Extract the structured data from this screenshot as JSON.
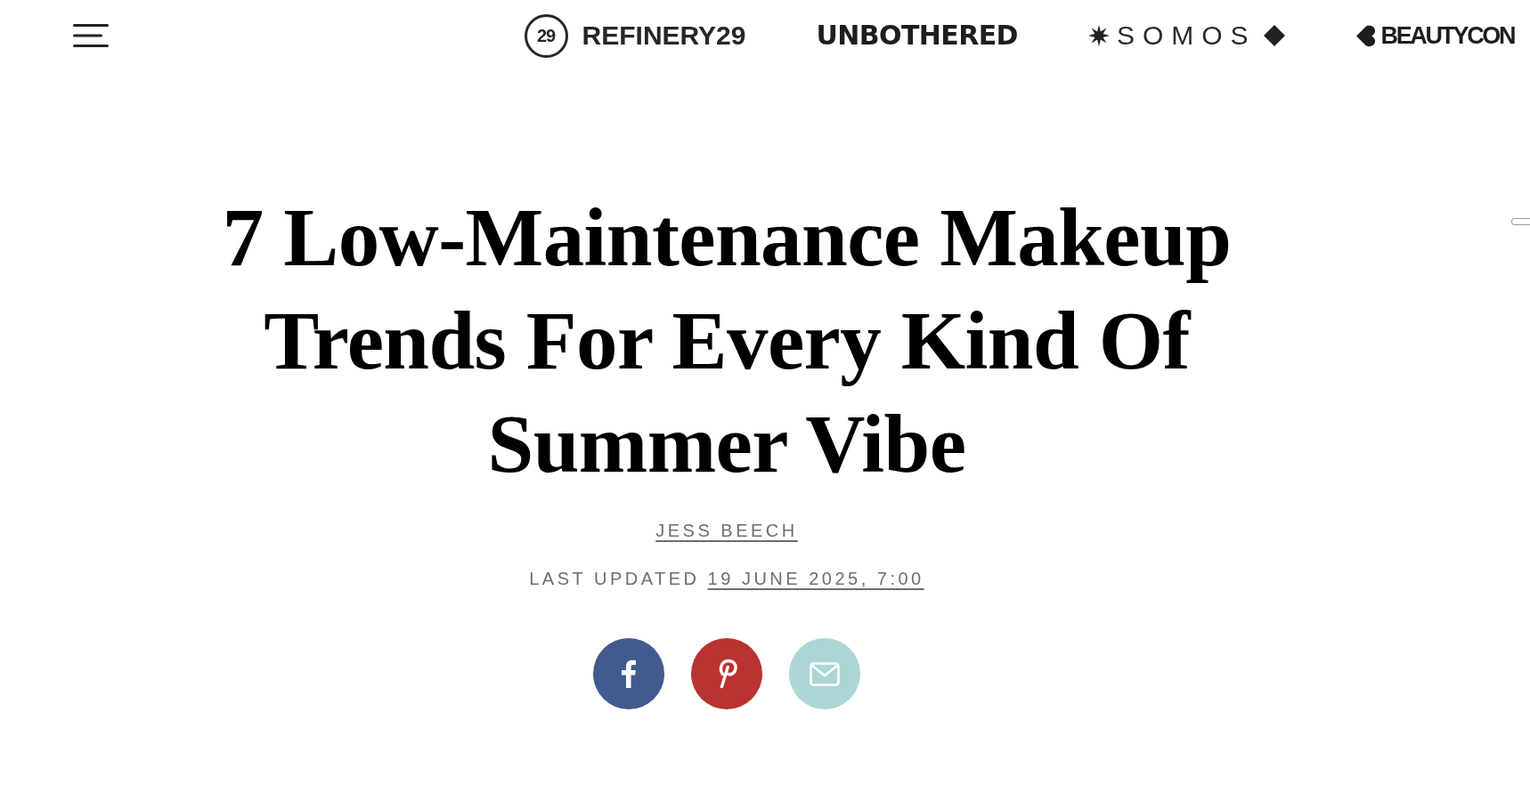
{
  "header": {
    "brands": [
      {
        "kind": "monogram",
        "monogram": "29",
        "label": "REFINERY29"
      },
      {
        "kind": "heavy",
        "label": "UNBOTHERED"
      },
      {
        "kind": "starred",
        "label": "SOMOS"
      },
      {
        "kind": "tagged",
        "label": "BEAUTYCON"
      }
    ]
  },
  "article": {
    "title": "7 Low-Maintenance Makeup Trends For Every Kind Of Summer Vibe",
    "author": "JESS BEECH",
    "updated_label": "LAST UPDATED",
    "updated_date": "19 JUNE 2025, 7:00",
    "share": [
      {
        "kind": "facebook",
        "color": "#435a91"
      },
      {
        "kind": "pinterest",
        "color": "#b93330"
      },
      {
        "kind": "email",
        "color": "#acd6d6"
      }
    ]
  }
}
